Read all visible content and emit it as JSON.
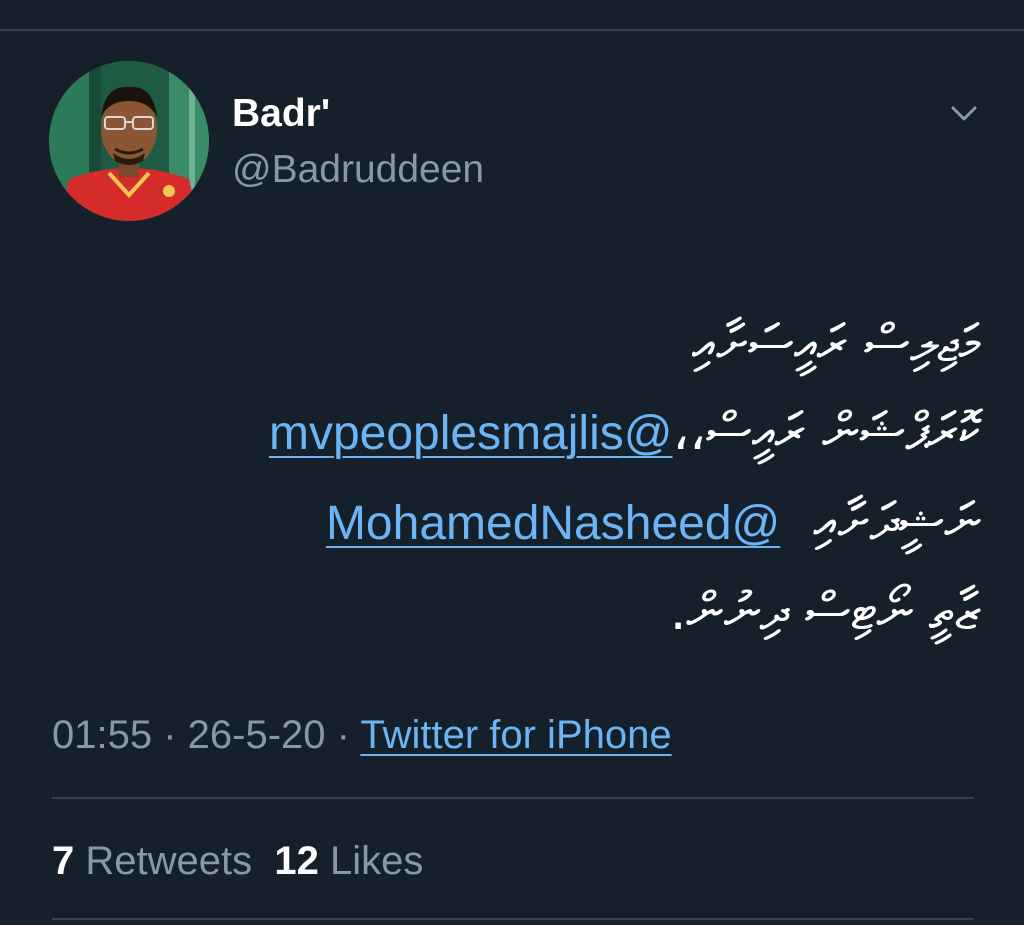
{
  "tweet": {
    "author": {
      "display_name": "Badr'",
      "handle": "@Badruddeen"
    },
    "body": {
      "line1": "މަޖިލިސް ރައީސަށާއި",
      "line2_prefix": "ކޮރަޕްޝަން ރައީސް،",
      "mention1": "@mvpeoplesmajlis",
      "line2_suffix": "،",
      "line3_prefix": "ނަޝީދަށާއި",
      "mention2": "@MohamedNasheed",
      "line4": "ޒާތީ ނޯޓިސް ދިނުން."
    },
    "timestamp": {
      "time": "01:55",
      "separator1": " · ",
      "date": "26-5-20",
      "separator2": " · ",
      "source": "Twitter for iPhone"
    },
    "stats": {
      "retweets_count": "7",
      "retweets_label": "Retweets",
      "likes_count": "12",
      "likes_label": "Likes"
    }
  },
  "colors": {
    "background": "#15202b",
    "divider": "#38444d",
    "link": "#6cb4f5",
    "secondary_text": "#8899a6",
    "primary_text": "#ffffff"
  },
  "icons": {
    "menu": "chevron-down-icon",
    "avatar": "profile-photo"
  }
}
